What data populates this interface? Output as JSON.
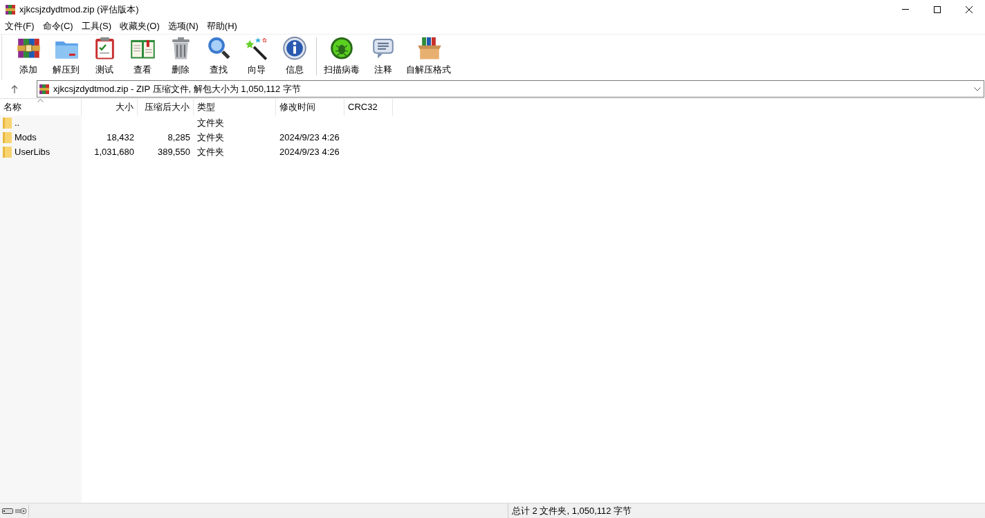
{
  "window": {
    "title": "xjkcsjzdydtmod.zip (评估版本)"
  },
  "menu": [
    "文件(F)",
    "命令(C)",
    "工具(S)",
    "收藏夹(O)",
    "选项(N)",
    "帮助(H)"
  ],
  "toolbar": [
    {
      "label": "添加"
    },
    {
      "label": "解压到"
    },
    {
      "label": "测试"
    },
    {
      "label": "查看"
    },
    {
      "label": "删除"
    },
    {
      "label": "查找"
    },
    {
      "label": "向导"
    },
    {
      "label": "信息"
    },
    {
      "label": "扫描病毒"
    },
    {
      "label": "注释"
    },
    {
      "label": "自解压格式"
    }
  ],
  "path": "xjkcsjzdydtmod.zip - ZIP 压缩文件, 解包大小为 1,050,112 字节",
  "table": {
    "columns": [
      {
        "label": "名称",
        "sorted": true
      },
      {
        "label": "大小",
        "sorted": false
      },
      {
        "label": "压缩后大小",
        "sorted": false
      },
      {
        "label": "类型",
        "sorted": false
      },
      {
        "label": "修改时间",
        "sorted": false
      },
      {
        "label": "CRC32",
        "sorted": false
      }
    ],
    "rows": [
      [
        "..",
        "",
        "",
        "文件夹",
        ""
      ],
      [
        "Mods",
        "18,432",
        "8,285",
        "文件夹",
        "2024/9/23 4:26"
      ],
      [
        "UserLibs",
        "1,031,680",
        "389,550",
        "文件夹",
        "2024/9/23 4:26"
      ]
    ]
  },
  "status_bar": "总计 2 文件夹, 1,050,112 字节"
}
